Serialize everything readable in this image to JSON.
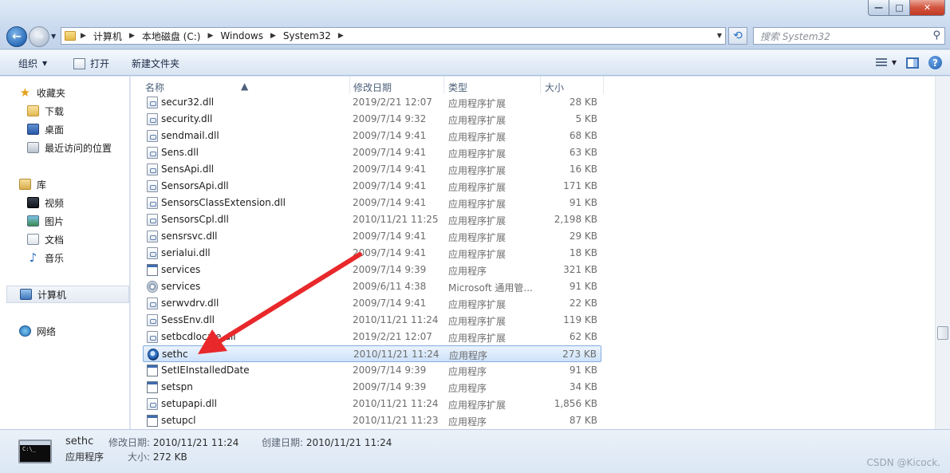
{
  "window": {
    "controls": {
      "minimize": "—",
      "maximize": "□",
      "close": "✕"
    }
  },
  "address": {
    "breadcrumb": [
      "计算机",
      "本地磁盘 (C:)",
      "Windows",
      "System32"
    ]
  },
  "search": {
    "placeholder": "搜索 System32"
  },
  "toolbar": {
    "organize": "组织",
    "open": "打开",
    "new_folder": "新建文件夹"
  },
  "navigation": {
    "favorites": {
      "label": "收藏夹",
      "items": [
        "下载",
        "桌面",
        "最近访问的位置"
      ]
    },
    "libraries": {
      "label": "库",
      "items": [
        "视频",
        "图片",
        "文档",
        "音乐"
      ]
    },
    "computer": "计算机",
    "network": "网络"
  },
  "columns": {
    "name": "名称",
    "modified": "修改日期",
    "type": "类型",
    "size": "大小"
  },
  "files": [
    {
      "name": "secur32.dll",
      "modified": "2019/2/21 12:07",
      "type": "应用程序扩展",
      "size": "28 KB",
      "icon": "dll-icon"
    },
    {
      "name": "security.dll",
      "modified": "2009/7/14 9:32",
      "type": "应用程序扩展",
      "size": "5 KB",
      "icon": "dll-icon"
    },
    {
      "name": "sendmail.dll",
      "modified": "2009/7/14 9:41",
      "type": "应用程序扩展",
      "size": "68 KB",
      "icon": "dll-icon"
    },
    {
      "name": "Sens.dll",
      "modified": "2009/7/14 9:41",
      "type": "应用程序扩展",
      "size": "63 KB",
      "icon": "dll-icon"
    },
    {
      "name": "SensApi.dll",
      "modified": "2009/7/14 9:41",
      "type": "应用程序扩展",
      "size": "16 KB",
      "icon": "dll-icon"
    },
    {
      "name": "SensorsApi.dll",
      "modified": "2009/7/14 9:41",
      "type": "应用程序扩展",
      "size": "171 KB",
      "icon": "dll-icon"
    },
    {
      "name": "SensorsClassExtension.dll",
      "modified": "2009/7/14 9:41",
      "type": "应用程序扩展",
      "size": "91 KB",
      "icon": "dll-icon"
    },
    {
      "name": "SensorsCpl.dll",
      "modified": "2010/11/21 11:25",
      "type": "应用程序扩展",
      "size": "2,198 KB",
      "icon": "dll-icon"
    },
    {
      "name": "sensrsvc.dll",
      "modified": "2009/7/14 9:41",
      "type": "应用程序扩展",
      "size": "29 KB",
      "icon": "dll-icon"
    },
    {
      "name": "serialui.dll",
      "modified": "2009/7/14 9:41",
      "type": "应用程序扩展",
      "size": "18 KB",
      "icon": "dll-icon"
    },
    {
      "name": "services",
      "modified": "2009/7/14 9:39",
      "type": "应用程序",
      "size": "321 KB",
      "icon": "exe-icon"
    },
    {
      "name": "services",
      "modified": "2009/6/11 4:38",
      "type": "Microsoft 通用管...",
      "size": "91 KB",
      "icon": "gear-icon"
    },
    {
      "name": "serwvdrv.dll",
      "modified": "2009/7/14 9:41",
      "type": "应用程序扩展",
      "size": "22 KB",
      "icon": "dll-icon"
    },
    {
      "name": "SessEnv.dll",
      "modified": "2010/11/21 11:24",
      "type": "应用程序扩展",
      "size": "119 KB",
      "icon": "dll-icon"
    },
    {
      "name": "setbcdlocale.dll",
      "modified": "2019/2/21 12:07",
      "type": "应用程序扩展",
      "size": "62 KB",
      "icon": "dll-icon"
    },
    {
      "name": "sethc",
      "modified": "2010/11/21 11:24",
      "type": "应用程序",
      "size": "273 KB",
      "icon": "sethc-icon",
      "selected": true
    },
    {
      "name": "SetIEInstalledDate",
      "modified": "2009/7/14 9:39",
      "type": "应用程序",
      "size": "91 KB",
      "icon": "exe-icon"
    },
    {
      "name": "setspn",
      "modified": "2009/7/14 9:39",
      "type": "应用程序",
      "size": "34 KB",
      "icon": "exe-icon"
    },
    {
      "name": "setupapi.dll",
      "modified": "2010/11/21 11:24",
      "type": "应用程序扩展",
      "size": "1,856 KB",
      "icon": "dll-icon"
    },
    {
      "name": "setupcl",
      "modified": "2010/11/21 11:23",
      "type": "应用程序",
      "size": "87 KB",
      "icon": "exe-icon"
    }
  ],
  "details": {
    "name": "sethc",
    "type": "应用程序",
    "modified_label": "修改日期:",
    "modified_value": "2010/11/21 11:24",
    "created_label": "创建日期:",
    "created_value": "2010/11/21 11:24",
    "size_label": "大小:",
    "size_value": "272 KB",
    "thumb_text": "C:\\_"
  },
  "watermark": "CSDN @Kicock.",
  "colors": {
    "annotation": "#e8282b",
    "selection": "#cde2f9"
  }
}
